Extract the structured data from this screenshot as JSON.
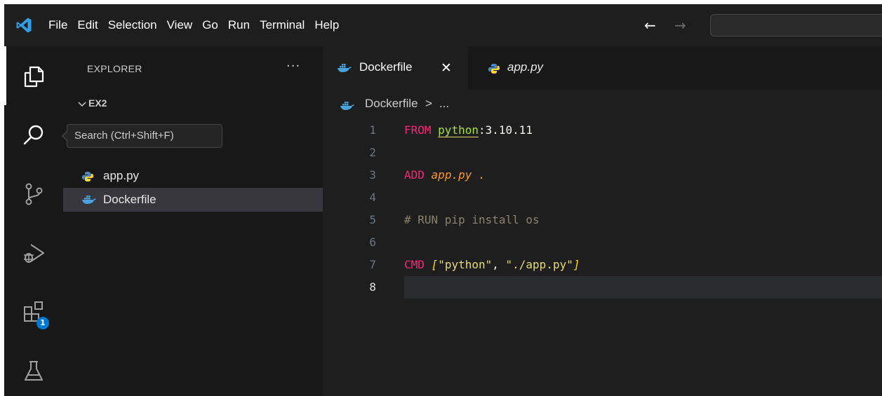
{
  "menubar": {
    "items": [
      "File",
      "Edit",
      "Selection",
      "View",
      "Go",
      "Run",
      "Terminal",
      "Help"
    ]
  },
  "nav": {
    "back": "←",
    "forward": "→"
  },
  "activitybar": {
    "items": [
      {
        "name": "explorer",
        "icon": "files-icon",
        "active": true
      },
      {
        "name": "search",
        "icon": "search-icon"
      },
      {
        "name": "source-control",
        "icon": "source-control-icon"
      },
      {
        "name": "run-and-debug",
        "icon": "run-debug-icon"
      },
      {
        "name": "extensions",
        "icon": "extensions-icon",
        "badge": "1"
      },
      {
        "name": "testing",
        "icon": "beaker-icon"
      }
    ]
  },
  "tooltip": {
    "text": "Search (Ctrl+Shift+F)"
  },
  "sidebar": {
    "title": "EXPLORER",
    "more": "···",
    "folder": "EX2",
    "files": [
      {
        "label": "app.py",
        "icon": "python-icon"
      },
      {
        "label": "Dockerfile",
        "icon": "docker-icon",
        "selected": true
      }
    ]
  },
  "tabs": [
    {
      "label": "Dockerfile",
      "icon": "docker-icon",
      "active": true,
      "close": "✕"
    },
    {
      "label": "app.py",
      "icon": "python-icon",
      "active": false
    }
  ],
  "breadcrumbs": {
    "file": "Dockerfile",
    "separator": ">",
    "more": "..."
  },
  "editor": {
    "lines": [
      {
        "number": "1",
        "tokens": [
          [
            "kw",
            "FROM"
          ],
          [
            "plain",
            " "
          ],
          [
            "img",
            "python"
          ],
          [
            "plain",
            ":3.10.11"
          ]
        ]
      },
      {
        "number": "2",
        "tokens": []
      },
      {
        "number": "3",
        "tokens": [
          [
            "kw",
            "ADD"
          ],
          [
            "plain",
            " "
          ],
          [
            "arg",
            "app.py ."
          ]
        ]
      },
      {
        "number": "4",
        "tokens": []
      },
      {
        "number": "5",
        "tokens": [
          [
            "comment",
            "# RUN pip install os"
          ]
        ]
      },
      {
        "number": "6",
        "tokens": []
      },
      {
        "number": "7",
        "tokens": [
          [
            "kw",
            "CMD"
          ],
          [
            "plain",
            " "
          ],
          [
            "bracket",
            "["
          ],
          [
            "str",
            "\"python\""
          ],
          [
            "punct",
            ", "
          ],
          [
            "str",
            "\"./app.py\""
          ],
          [
            "bracket",
            "]"
          ]
        ]
      },
      {
        "number": "8",
        "tokens": [],
        "current": true
      }
    ]
  },
  "colors": {
    "keyword": "#f92672",
    "string": "#e6db74",
    "comment": "#88846f",
    "argument": "#fd971f",
    "image": "#a6e22e",
    "accent": "#0078d4"
  }
}
